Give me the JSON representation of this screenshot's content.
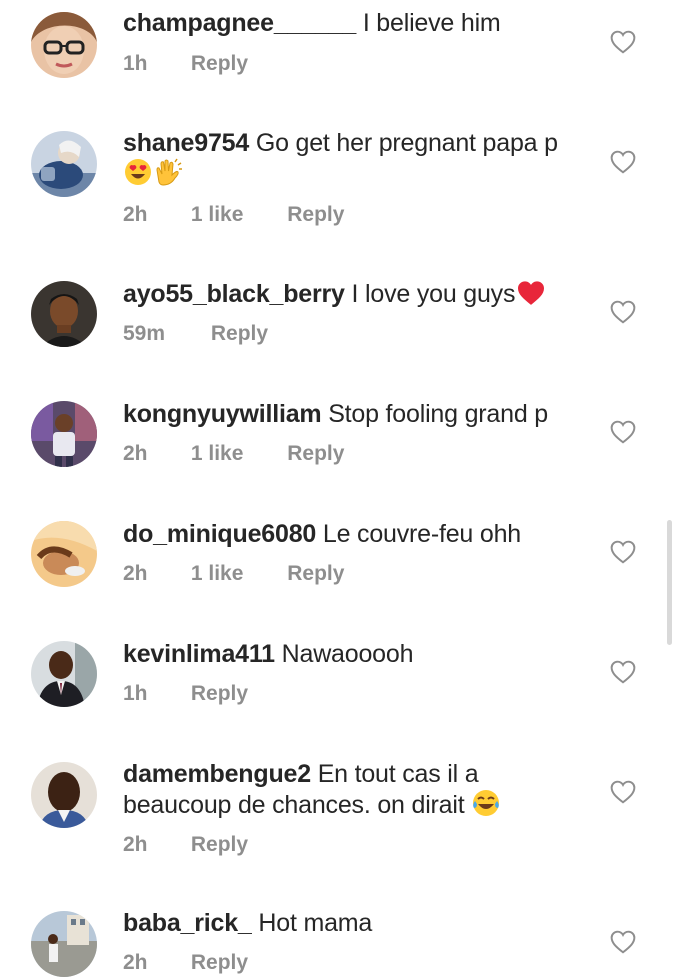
{
  "comments": [
    {
      "username": "champagnee______",
      "text": "I believe him",
      "time": "1h",
      "likes": "",
      "reply": "Reply",
      "avatar_icon": "avatar-glasses-woman"
    },
    {
      "username": "shane9754",
      "text": "Go get her pregnant papa p",
      "time": "2h",
      "likes": "1 like",
      "reply": "Reply",
      "avatar_icon": "avatar-seated-person",
      "emojis": [
        "heart-eyes-emoji",
        "clapping-hands-emoji"
      ]
    },
    {
      "username": "ayo55_black_berry",
      "text": "I love you guys",
      "time": "59m",
      "likes": "",
      "reply": "Reply",
      "avatar_icon": "avatar-man-portrait",
      "emojis": [
        "red-heart-emoji"
      ]
    },
    {
      "username": "kongnyuywilliam",
      "text": "Stop fooling grand p",
      "time": "2h",
      "likes": "1 like",
      "reply": "Reply",
      "avatar_icon": "avatar-child-standing"
    },
    {
      "username": "do_minique6080",
      "text": "Le couvre-feu ohh",
      "time": "2h",
      "likes": "1 like",
      "reply": "Reply",
      "avatar_icon": "avatar-woman-lying"
    },
    {
      "username": "kevinlima411",
      "text": "Nawaooooh",
      "time": "1h",
      "likes": "",
      "reply": "Reply",
      "avatar_icon": "avatar-man-suit"
    },
    {
      "username": "damembengue2",
      "text": "En tout cas il a beaucoup de chances. on dirait",
      "time": "2h",
      "likes": "",
      "reply": "Reply",
      "avatar_icon": "avatar-man-face",
      "emojis": [
        "tears-of-joy-emoji"
      ]
    },
    {
      "username": "baba_rick_",
      "text": "Hot mama",
      "time": "2h",
      "likes": "",
      "reply": "Reply",
      "avatar_icon": "avatar-street-scene"
    }
  ],
  "colors": {
    "text": "#262626",
    "meta": "#8e8e8e",
    "heart_outline": "#8e8e8e",
    "background": "#ffffff"
  },
  "icons": {
    "like": "heart-outline-icon"
  }
}
